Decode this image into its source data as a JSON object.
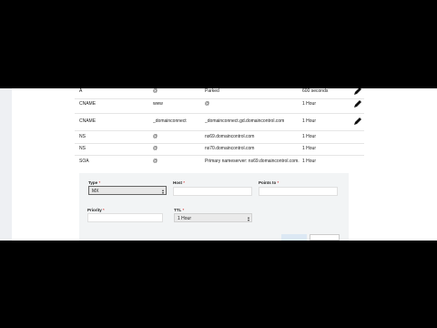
{
  "records": [
    {
      "type": "A",
      "name": "@",
      "value": "Parked",
      "ttl": "600 seconds"
    },
    {
      "type": "CNAME",
      "name": "www",
      "value": "@",
      "ttl": "1 Hour"
    },
    {
      "type": "CNAME",
      "name": "_domainconnect",
      "value": "_domainconnect.gd.domaincontrol.com",
      "ttl": "1 Hour"
    },
    {
      "type": "NS",
      "name": "@",
      "value": "ns69.domaincontrol.com",
      "ttl": "1 Hour"
    },
    {
      "type": "NS",
      "name": "@",
      "value": "ns70.domaincontrol.com",
      "ttl": "1 Hour"
    },
    {
      "type": "SOA",
      "name": "@",
      "value": "Primary nameserver: ns69.domaincontrol.com.",
      "ttl": "1 Hour"
    }
  ],
  "form": {
    "type_label": "Type",
    "type_value": "MX",
    "host_label": "Host",
    "host_value": "",
    "points_to_label": "Points to",
    "points_to_value": "",
    "priority_label": "Priority",
    "priority_value": "",
    "ttl_label": "TTL",
    "ttl_value": "1 Hour",
    "required_mark": "*"
  },
  "icons": {
    "edit": "pencil-icon",
    "select": "chevron-updown-icon"
  },
  "colors": {
    "form_bg": "#f2f4f5",
    "save_button": "#dce8f4",
    "required": "#cc0000"
  }
}
